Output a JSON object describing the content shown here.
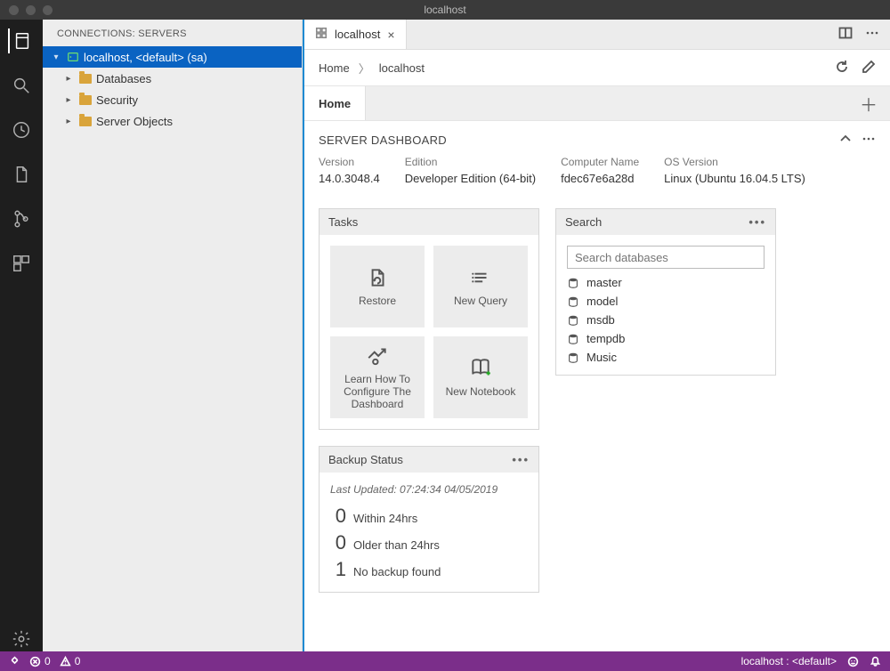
{
  "window": {
    "title": "localhost"
  },
  "sidebar": {
    "header": "CONNECTIONS: SERVERS",
    "root": {
      "label": "localhost, <default> (sa)"
    },
    "children": [
      {
        "label": "Databases"
      },
      {
        "label": "Security"
      },
      {
        "label": "Server Objects"
      }
    ]
  },
  "tab": {
    "label": "localhost"
  },
  "breadcrumb": {
    "a": "Home",
    "b": "localhost"
  },
  "subtab": {
    "label": "Home"
  },
  "dashboard": {
    "title": "SERVER DASHBOARD",
    "props": {
      "version": {
        "k": "Version",
        "v": "14.0.3048.4"
      },
      "edition": {
        "k": "Edition",
        "v": "Developer Edition (64-bit)"
      },
      "computer": {
        "k": "Computer Name",
        "v": "fdec67e6a28d"
      },
      "os": {
        "k": "OS Version",
        "v": "Linux (Ubuntu 16.04.5 LTS)"
      }
    }
  },
  "tasks": {
    "title": "Tasks",
    "items": {
      "restore": "Restore",
      "newquery": "New Query",
      "learn": "Learn How To Configure The Dashboard",
      "notebook": "New Notebook"
    }
  },
  "search": {
    "title": "Search",
    "placeholder": "Search databases",
    "dbs": [
      {
        "name": "master"
      },
      {
        "name": "model"
      },
      {
        "name": "msdb"
      },
      {
        "name": "tempdb"
      },
      {
        "name": "Music"
      }
    ]
  },
  "backup": {
    "title": "Backup Status",
    "updated": "Last Updated: 07:24:34 04/05/2019",
    "rows": [
      {
        "n": "0",
        "l": "Within 24hrs"
      },
      {
        "n": "0",
        "l": "Older than 24hrs"
      },
      {
        "n": "1",
        "l": "No backup found"
      }
    ]
  },
  "status": {
    "errors": "0",
    "warnings": "0",
    "connection": "localhost : <default>"
  }
}
